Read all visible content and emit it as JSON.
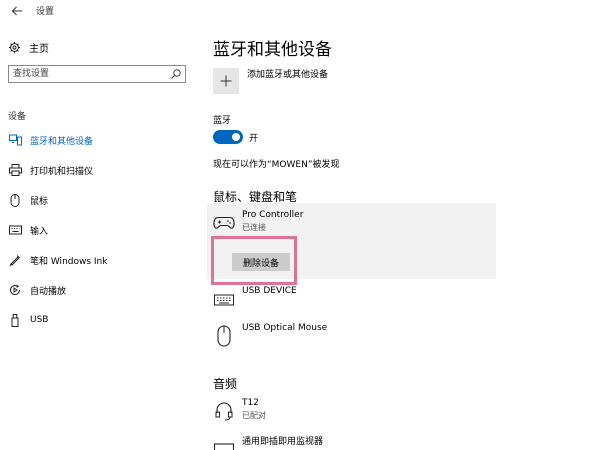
{
  "window": {
    "title": "设置"
  },
  "sidebar": {
    "home_label": "主页",
    "search_placeholder": "查找设置",
    "section_label": "设备",
    "items": [
      {
        "label": "蓝牙和其他设备",
        "icon": "bluetooth-devices-icon",
        "active": true
      },
      {
        "label": "打印机和扫描仪",
        "icon": "printer-icon",
        "active": false
      },
      {
        "label": "鼠标",
        "icon": "mouse-icon",
        "active": false
      },
      {
        "label": "输入",
        "icon": "keyboard-icon",
        "active": false
      },
      {
        "label": "笔和 Windows Ink",
        "icon": "pen-icon",
        "active": false
      },
      {
        "label": "自动播放",
        "icon": "autoplay-icon",
        "active": false
      },
      {
        "label": "USB",
        "icon": "usb-icon",
        "active": false
      }
    ]
  },
  "main": {
    "title": "蓝牙和其他设备",
    "add_device_label": "添加蓝牙或其他设备",
    "bluetooth_label": "蓝牙",
    "bluetooth_state": "开",
    "discoverable_text": "现在可以作为“MOWEN”被发现",
    "sections": [
      {
        "title": "鼠标、键盘和笔",
        "devices": [
          {
            "name": "Pro Controller",
            "status": "已连接",
            "icon": "gamepad-icon",
            "selected": true
          },
          {
            "name": "USB DEVICE",
            "status": "",
            "icon": "keyboard-icon"
          },
          {
            "name": "USB Optical Mouse",
            "status": "",
            "icon": "mouse-icon"
          }
        ]
      },
      {
        "title": "音频",
        "devices": [
          {
            "name": "T12",
            "status": "已配对",
            "icon": "headset-icon"
          },
          {
            "name": "通用即插即用监视器",
            "status": "",
            "icon": "monitor-icon"
          }
        ]
      }
    ],
    "remove_button_label": "删除设备"
  },
  "colors": {
    "accent": "#0067c0",
    "highlight_border": "#e0729a",
    "selected_card": "#f2f2f2",
    "button_bg": "#cccccc"
  }
}
